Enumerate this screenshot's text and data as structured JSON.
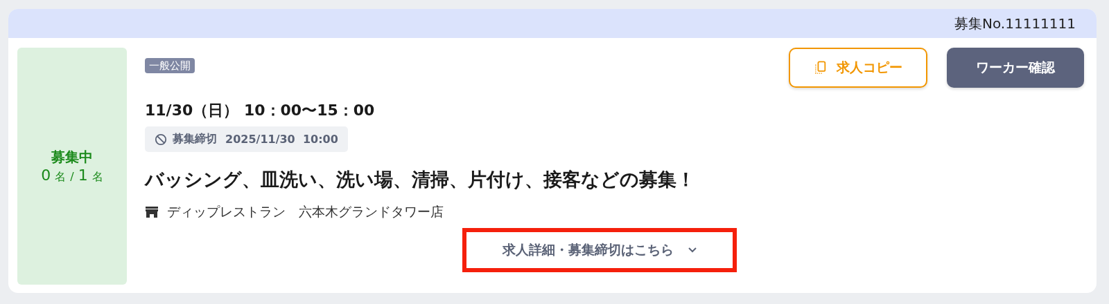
{
  "header": {
    "recruit_no": "募集No.11111111"
  },
  "status": {
    "label": "募集中",
    "filled": "0",
    "filled_unit": "名",
    "separator": "/",
    "capacity": "1",
    "capacity_unit": "名"
  },
  "visibility_badge": "一般公開",
  "schedule": "11/30（日） 10：00〜15：00",
  "deadline": {
    "label": "募集締切",
    "value": "2025/11/30  10:00"
  },
  "title": "バッシング、皿洗い、洗い場、清掃、片付け、接客などの募集！",
  "store": "ディップレストラン　六本木グランドタワー店",
  "buttons": [
    {
      "kind": "outline",
      "label": "求人コピー"
    },
    {
      "kind": "filled",
      "label": "ワーカー確認"
    }
  ],
  "details_toggle": {
    "label": "求人詳細・募集締切はこちら",
    "expanded": false,
    "highlighted": true
  }
}
